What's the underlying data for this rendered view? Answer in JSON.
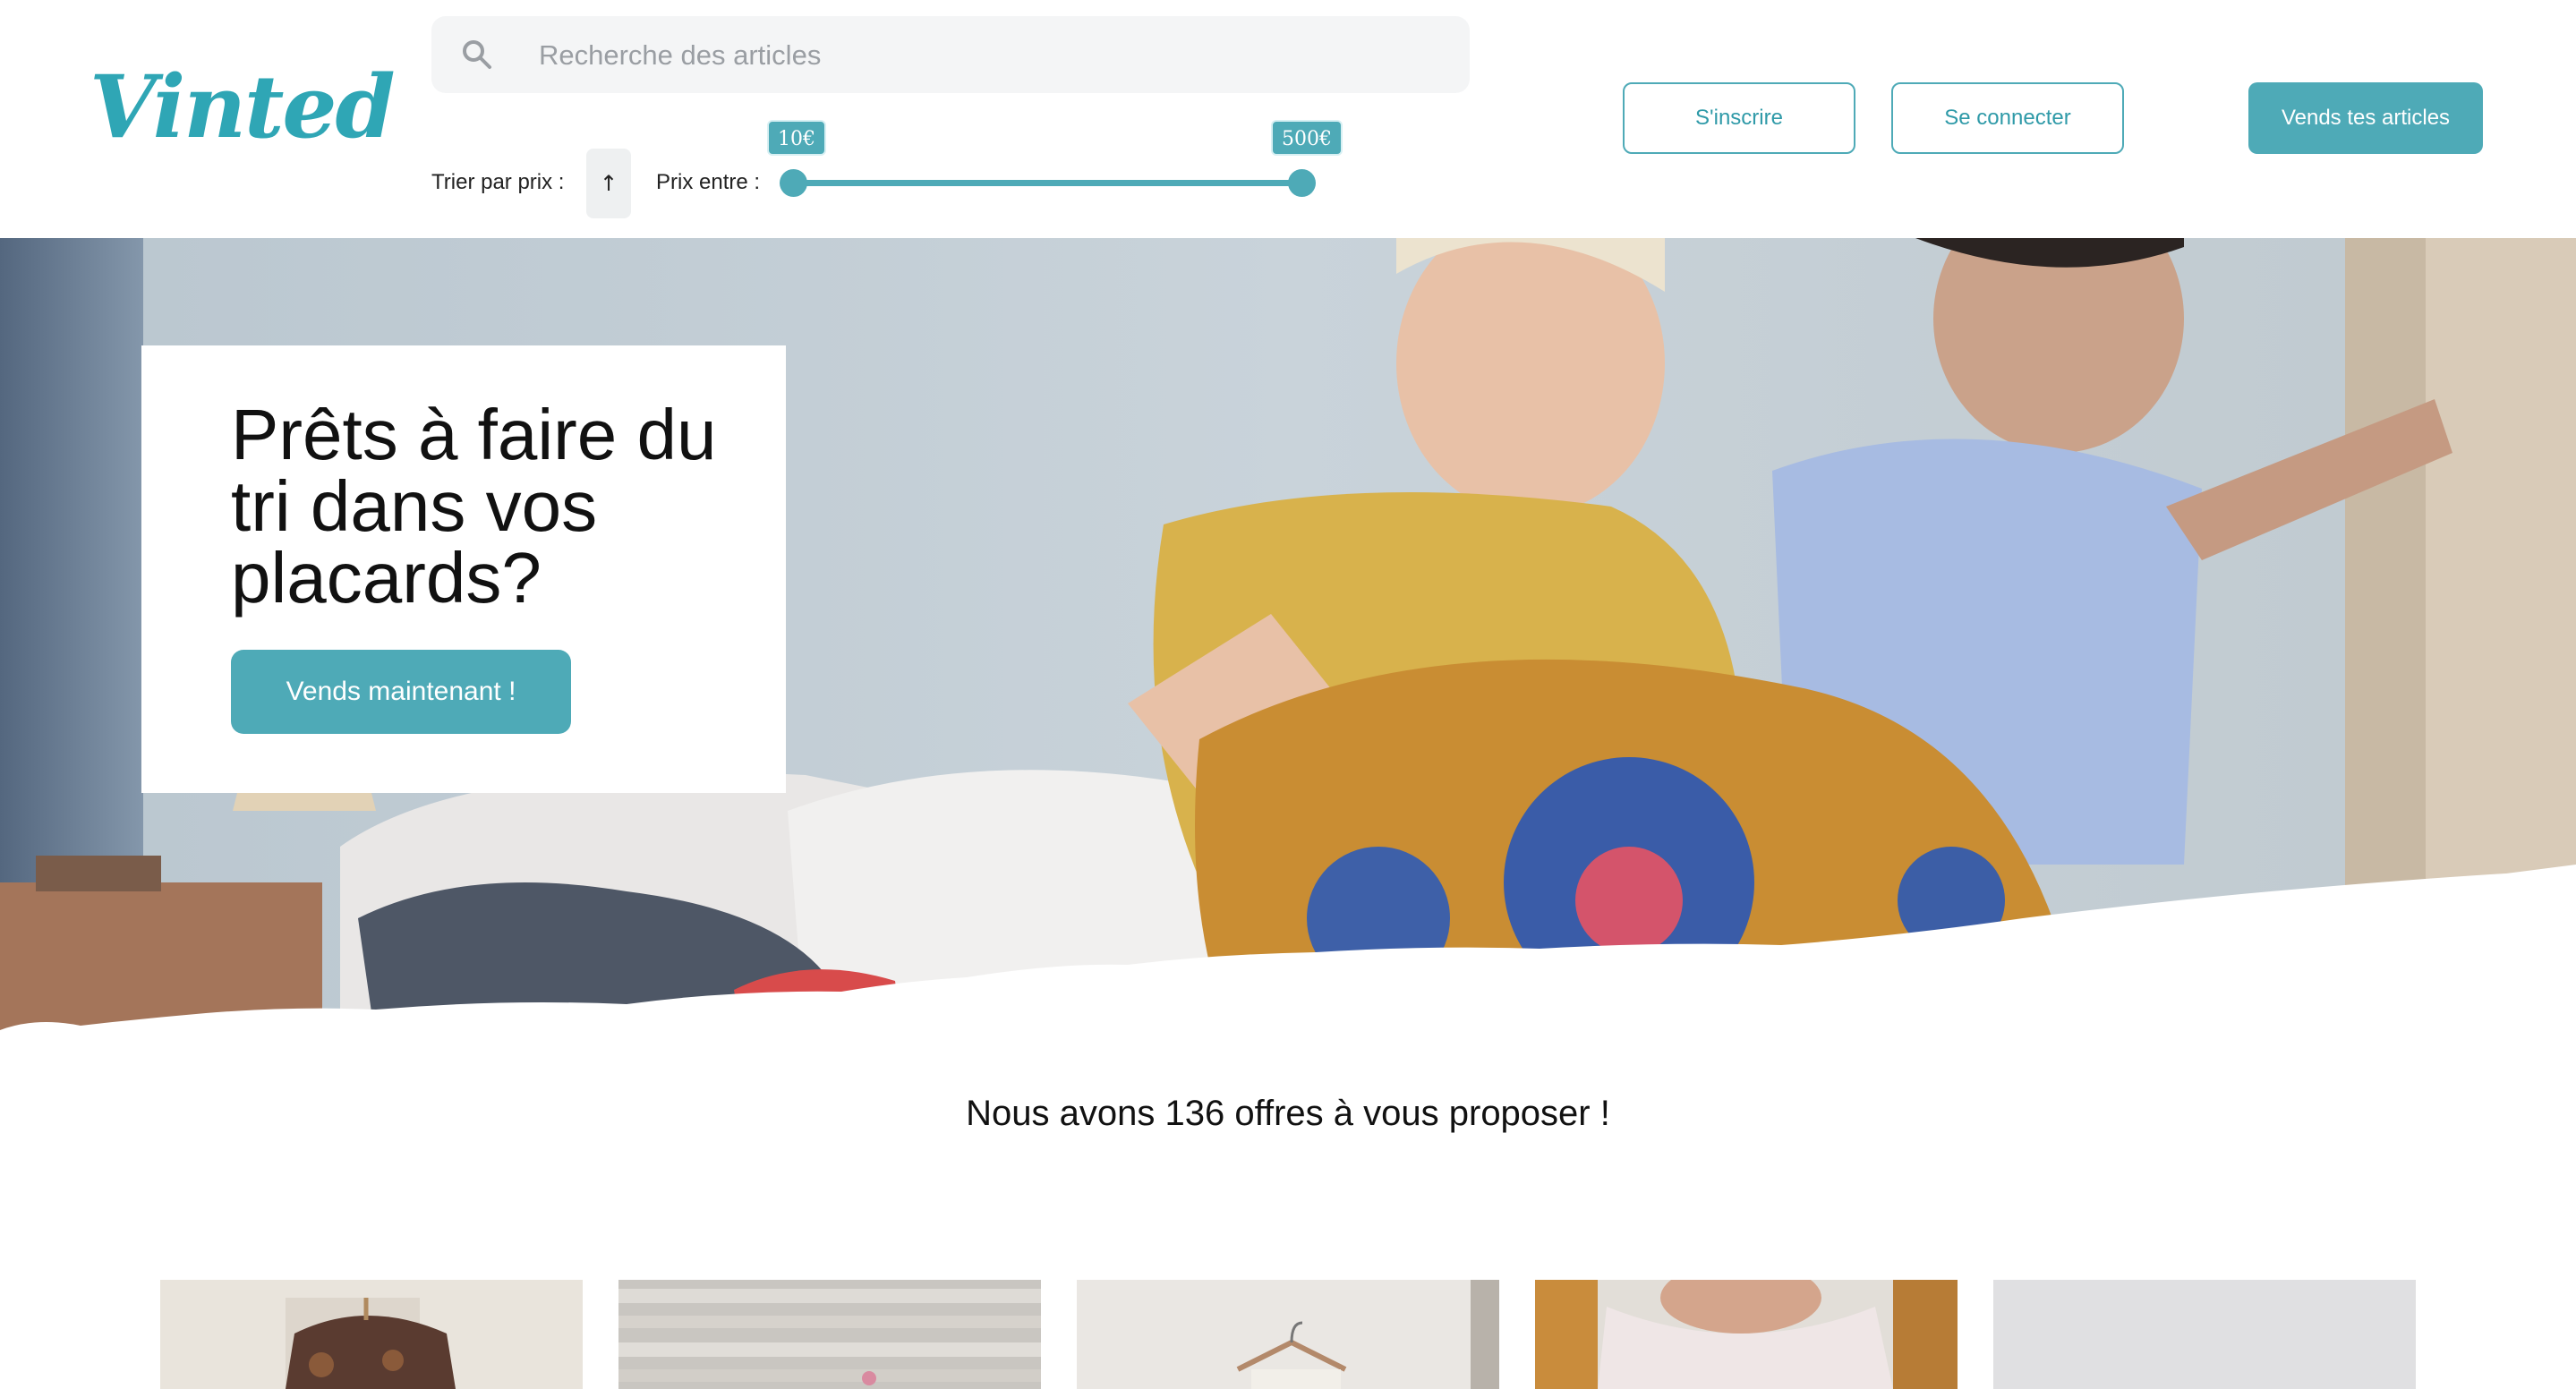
{
  "brand": {
    "logo_text": "Vinted",
    "accent_color": "#4eaab7"
  },
  "search": {
    "placeholder": "Recherche des articles",
    "icon": "search-icon"
  },
  "filters": {
    "sort_label": "Trier par prix :",
    "sort_direction_symbol": "↑",
    "price_label": "Prix entre :",
    "price_min_label": "10€",
    "price_max_label": "500€",
    "price_min": 10,
    "price_max": 500
  },
  "nav": {
    "signup_label": "S'inscrire",
    "login_label": "Se connecter",
    "sell_label": "Vends tes articles"
  },
  "hero": {
    "title": "Prêts à faire du tri dans vos placards?",
    "cta_label": "Vends maintenant !"
  },
  "offers": {
    "count_text": "Nous avons 136 offres à vous proposer !",
    "cards": [
      {
        "kind": "shirt-on-hanger"
      },
      {
        "kind": "wooden-wall-item"
      },
      {
        "kind": "hanger-on-wall"
      },
      {
        "kind": "person-in-top"
      },
      {
        "kind": "grey-backdrop"
      }
    ]
  }
}
